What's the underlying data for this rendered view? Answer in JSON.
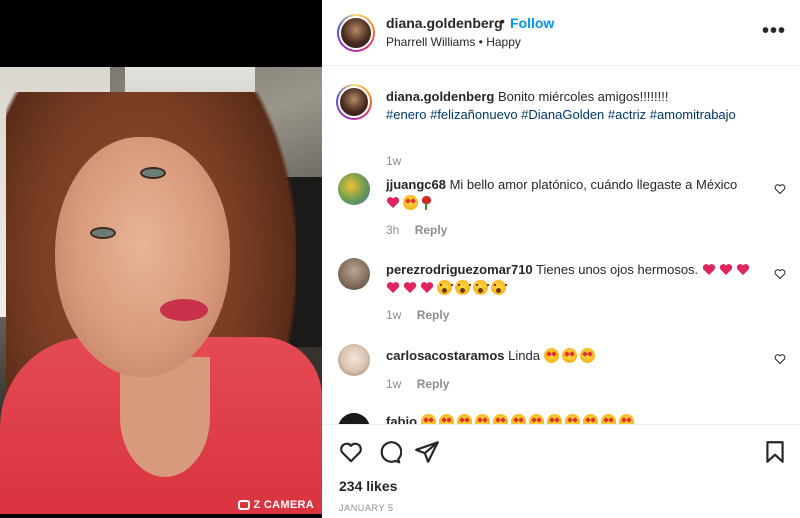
{
  "post": {
    "username": "diana.goldenberg",
    "separator": "•",
    "follow_label": "Follow",
    "music": "Pharrell Williams • Happy",
    "watermark": "Z CAMERA",
    "caption": "Bonito miércoles amigos!!!!!!!!",
    "hashtags": "#enero #felizañonuevo #DianaGolden #actriz #amomitrabajo",
    "caption_time": "1w"
  },
  "comments": [
    {
      "username": "jjuangc68",
      "text": "Mi bello amor platónico, cuándo llegaste a México",
      "emoji_line": [
        "heart-red",
        "star-eyes",
        "rose"
      ],
      "time": "3h",
      "reply_label": "Reply"
    },
    {
      "username": "perezrodriguezomar710",
      "text": "Tienes unos ojos hermosos.",
      "emoji_inline": [
        "heart-red",
        "heart-red",
        "heart-red"
      ],
      "emoji_line": [
        "heart-red",
        "heart-red",
        "heart-red",
        "astonished",
        "astonished",
        "astonished",
        "astonished"
      ],
      "time": "1w",
      "reply_label": "Reply"
    },
    {
      "username": "carlosacostaramos",
      "text": "Linda",
      "emoji_inline": [
        "star-eyes",
        "star-eyes",
        "star-eyes"
      ],
      "time": "1w",
      "reply_label": "Reply"
    },
    {
      "username": "fabio",
      "text": "",
      "emoji_inline": [
        "star-eyes",
        "star-eyes",
        "star-eyes",
        "star-eyes",
        "star-eyes",
        "star-eyes",
        "star-eyes",
        "star-eyes",
        "star-eyes",
        "star-eyes",
        "star-eyes",
        "star-eyes"
      ]
    }
  ],
  "actions": {
    "like_icon": "heart-outline-icon",
    "comment_icon": "comment-icon",
    "share_icon": "paper-plane-icon",
    "save_icon": "bookmark-icon"
  },
  "likes": "234 likes",
  "date": "JANUARY 5",
  "colors": {
    "follow": "#0095f6",
    "hashtag": "#00376b",
    "muted": "#8e8e8e",
    "text": "#262626"
  }
}
